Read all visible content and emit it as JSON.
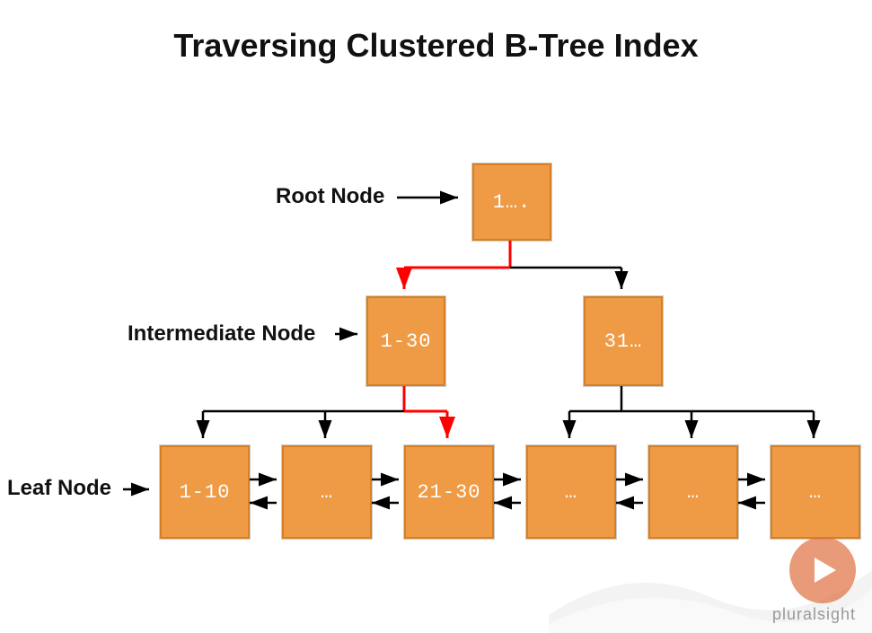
{
  "title": "Traversing Clustered B-Tree Index",
  "labels": {
    "root": "Root Node",
    "intermediate": "Intermediate Node",
    "leaf": "Leaf Node"
  },
  "nodes": {
    "root": {
      "text": "1….",
      "highlighted": false
    },
    "intermediate": [
      {
        "text": "1-30",
        "highlighted": true
      },
      {
        "text": "31…",
        "highlighted": false
      }
    ],
    "leaves": [
      {
        "text": "1-10"
      },
      {
        "text": "…"
      },
      {
        "text": "21-30",
        "highlighted": true
      },
      {
        "text": "…"
      },
      {
        "text": "…"
      },
      {
        "text": "…"
      }
    ]
  },
  "traversal_path": [
    "root",
    "intermediate[0]",
    "leaves[2]"
  ],
  "colors": {
    "node_fill": "#ef9b45",
    "node_border": "#d77f22",
    "arrow": "#000000",
    "highlight_arrow": "#ff0000"
  },
  "brand": "pluralsight"
}
